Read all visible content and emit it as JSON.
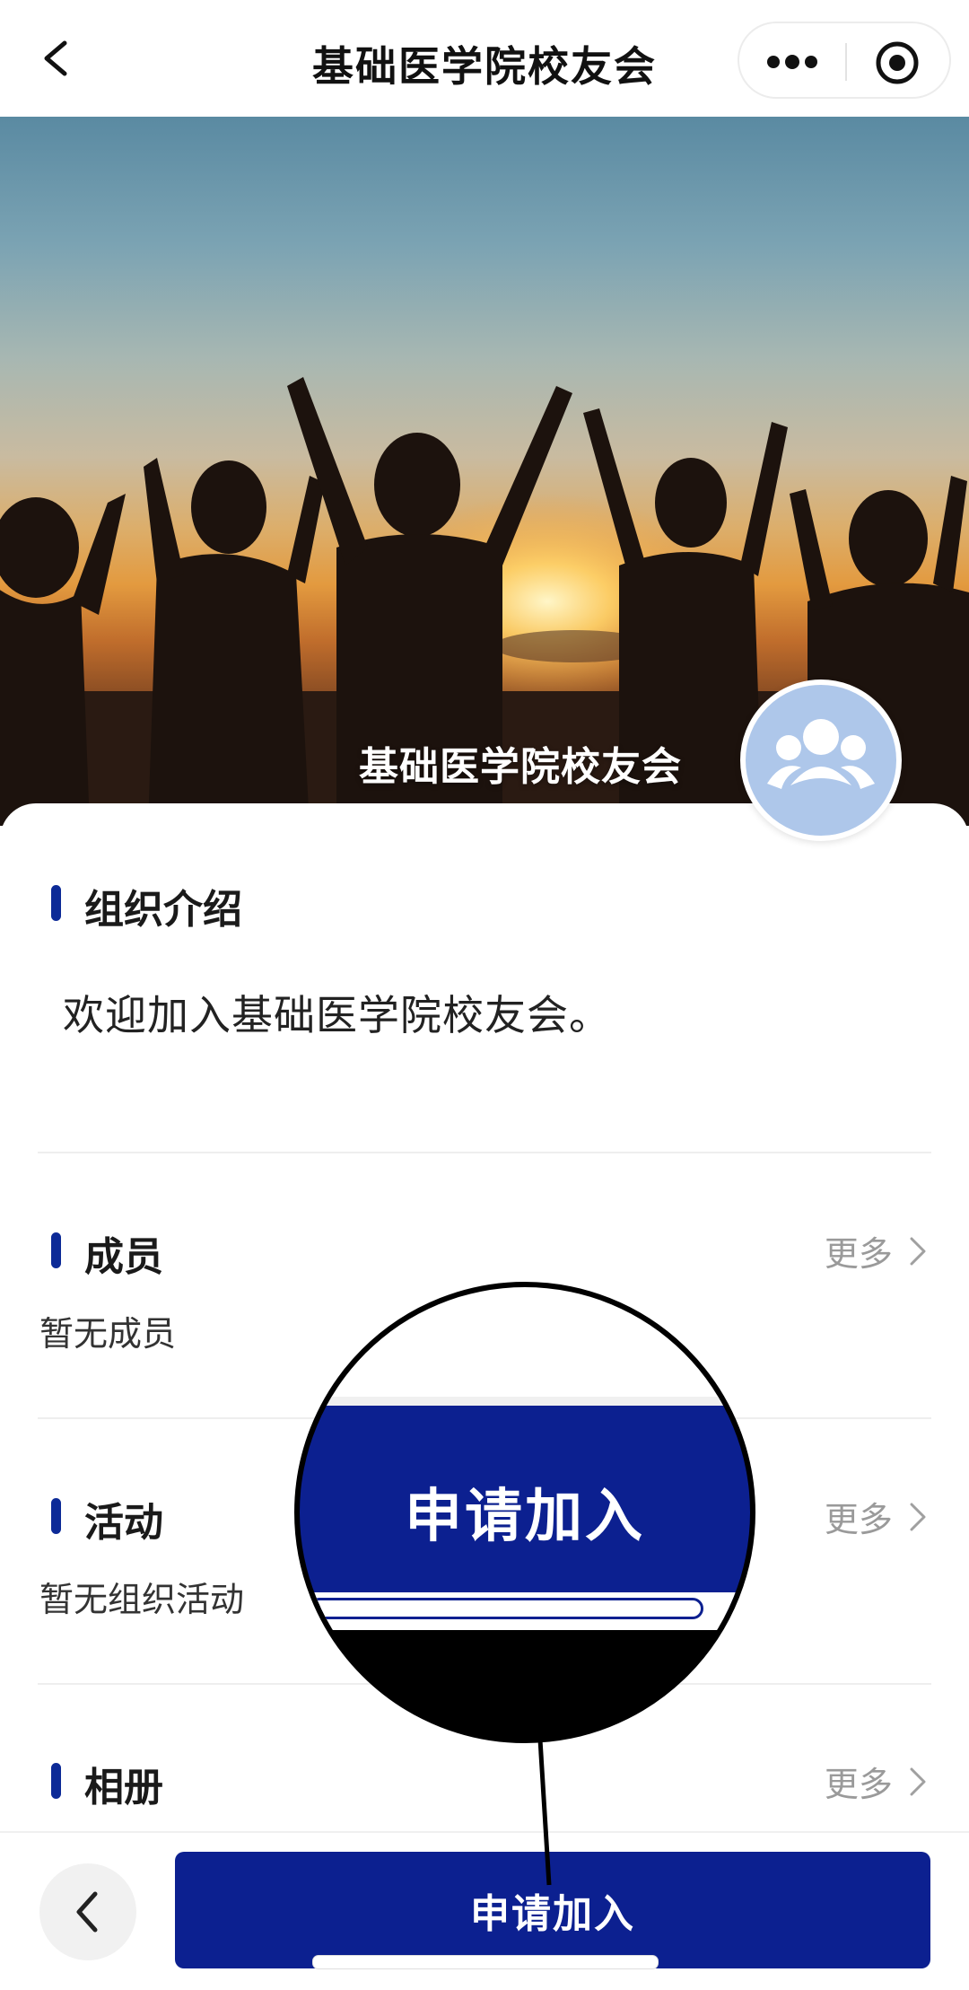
{
  "nav": {
    "title": "基础医学院校友会",
    "back_icon": "chevron-left-icon",
    "more_icon": "more-dots-icon",
    "target_icon": "target-circle-icon"
  },
  "hero": {
    "title": "基础医学院校友会",
    "avatar_icon": "group-people-icon"
  },
  "sections": {
    "intro": {
      "title": "组织介绍",
      "text": "欢迎加入基础医学院校友会。"
    },
    "members": {
      "title": "成员",
      "more": "更多",
      "empty": "暂无成员"
    },
    "activities": {
      "title": "活动",
      "more": "更多",
      "empty": "暂无组织活动"
    },
    "album": {
      "title": "相册",
      "more": "更多"
    }
  },
  "bottom": {
    "apply_label": "申请加入",
    "back_icon": "chevron-left-icon"
  },
  "magnifier": {
    "label": "申请加入"
  },
  "colors": {
    "accent": "#0c2090",
    "section_bar": "#0c2a97",
    "muted_text": "#9a9a9a",
    "avatar_bg": "#aec7ea"
  }
}
